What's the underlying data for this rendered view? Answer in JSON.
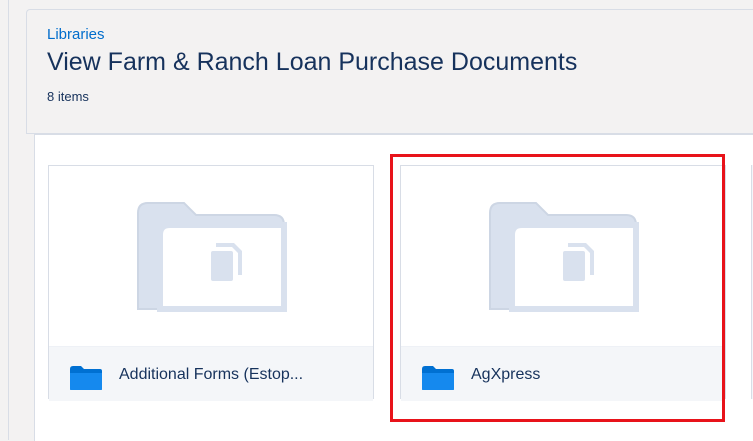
{
  "header": {
    "breadcrumb": "Libraries",
    "title": "View Farm & Ranch Loan Purchase Documents",
    "count": "8 items"
  },
  "cards": [
    {
      "label": "Additional Forms (Estop...",
      "icon": "folder-icon"
    },
    {
      "label": "AgXpress",
      "icon": "folder-icon"
    }
  ],
  "colors": {
    "link": "#006dcc",
    "text": "#16325c",
    "folder": "#0070d2",
    "placeholder": "#d9e1ee",
    "highlight": "#e8131a"
  }
}
